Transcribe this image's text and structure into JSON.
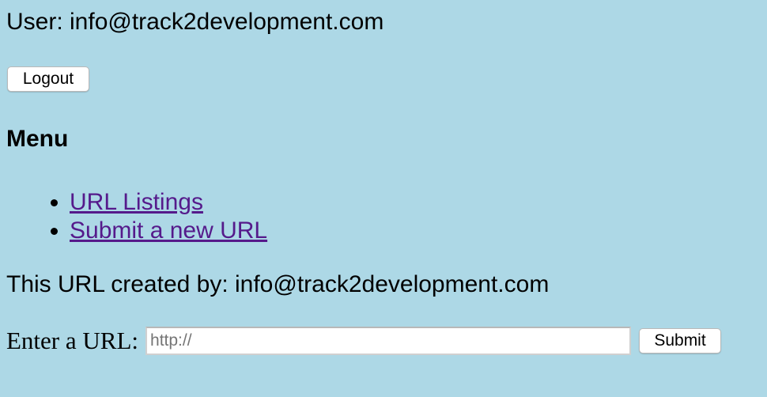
{
  "header": {
    "user_line": "User: info@track2development.com",
    "logout_label": "Logout"
  },
  "menu": {
    "heading": "Menu",
    "items": [
      {
        "label": "URL Listings"
      },
      {
        "label": "Submit a new URL"
      }
    ]
  },
  "main": {
    "created_line": "This URL created by: info@track2development.com",
    "url_form": {
      "label": "Enter a URL:",
      "placeholder": "http://",
      "value": "",
      "submit_label": "Submit"
    }
  },
  "colors": {
    "background": "#add8e6",
    "link_visited": "#551a8b"
  }
}
